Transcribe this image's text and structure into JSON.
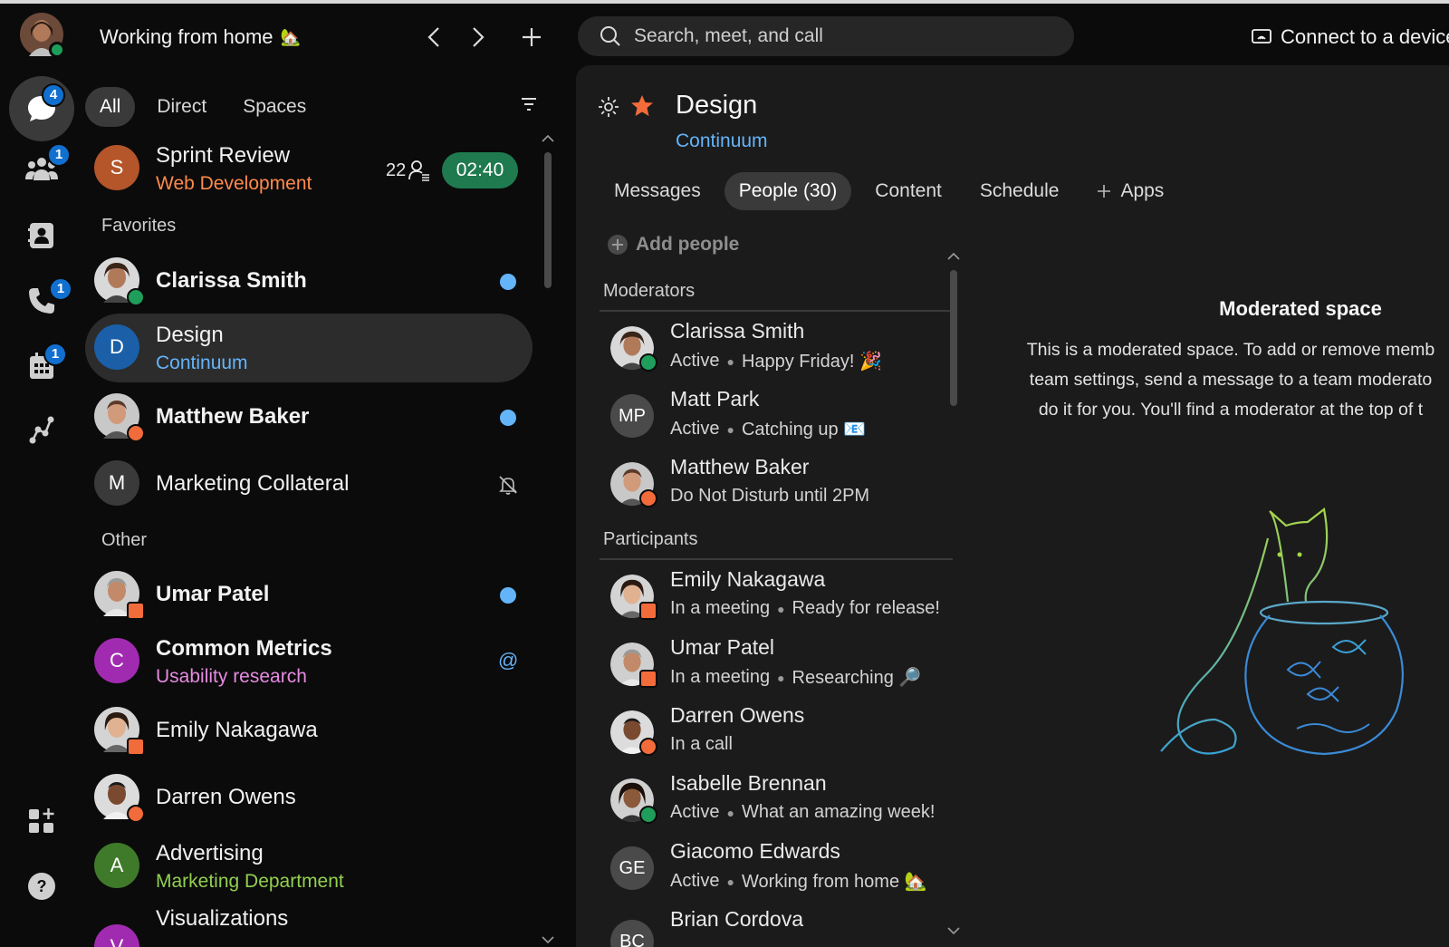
{
  "topbar": {
    "status_text": "Working from home",
    "status_emoji": "🏡",
    "search_placeholder": "Search, meet, and call",
    "connect_label": "Connect to a device",
    "back_symbol": "‹",
    "forward_symbol": "›",
    "new_symbol": "+"
  },
  "rail": {
    "items": [
      {
        "name": "messaging",
        "icon": "chat-bubble-icon",
        "badge": "4"
      },
      {
        "name": "teams",
        "icon": "people-icon",
        "badge": "1"
      },
      {
        "name": "contacts",
        "icon": "contact-card-icon",
        "badge": ""
      },
      {
        "name": "calling",
        "icon": "phone-icon",
        "badge": "1"
      },
      {
        "name": "meetings",
        "icon": "calendar-icon",
        "badge": "1"
      },
      {
        "name": "workflows",
        "icon": "network-icon",
        "badge": ""
      },
      {
        "name": "apps",
        "icon": "app-grid-icon",
        "badge": ""
      },
      {
        "name": "help",
        "icon": "help-icon",
        "badge": ""
      }
    ]
  },
  "list": {
    "filters": [
      "All",
      "Direct",
      "Spaces"
    ],
    "active_filter": "All",
    "favorites_label": "Favorites",
    "other_label": "Other",
    "meeting": {
      "name": "Sprint Review",
      "sub": "Web Development",
      "initial": "S",
      "count": "22",
      "timer": "02:40"
    },
    "favorites": [
      {
        "name": "Clarissa Smith",
        "sub": "",
        "initial": "",
        "bold": true,
        "unread": true
      },
      {
        "name": "Design",
        "sub": "Continuum",
        "initial": "D",
        "bold": false,
        "unread": false
      },
      {
        "name": "Matthew Baker",
        "sub": "",
        "initial": "",
        "bold": true,
        "unread": true
      },
      {
        "name": "Marketing Collateral",
        "sub": "",
        "initial": "M",
        "bold": false,
        "unread": false
      }
    ],
    "other": [
      {
        "name": "Umar Patel",
        "sub": "",
        "bold": true
      },
      {
        "name": "Common Metrics",
        "sub": "Usability research",
        "initial": "C",
        "bold": true
      },
      {
        "name": "Emily Nakagawa",
        "sub": "",
        "bold": false
      },
      {
        "name": "Darren Owens",
        "sub": "",
        "bold": false
      },
      {
        "name": "Advertising",
        "sub": "Marketing Department",
        "initial": "A",
        "bold": false
      },
      {
        "name": "Visualizations",
        "sub": "",
        "initial": "V",
        "bold": false
      }
    ],
    "mention_symbol": "@"
  },
  "space": {
    "title": "Design",
    "subtitle": "Continuum",
    "tabs": [
      "Messages",
      "People (30)",
      "Content",
      "Schedule",
      "Apps"
    ],
    "active_tab": "People (30)",
    "add_people": "Add people",
    "moderators_label": "Moderators",
    "participants_label": "Participants",
    "moderators": [
      {
        "name": "Clarissa Smith",
        "availability": "Active",
        "message": "Happy Friday! 🎉",
        "initials": ""
      },
      {
        "name": "Matt Park",
        "availability": "Active",
        "message": "Catching up 📧",
        "initials": "MP"
      },
      {
        "name": "Matthew Baker",
        "availability": "Do Not Disturb until 2PM",
        "message": "",
        "initials": ""
      }
    ],
    "participants": [
      {
        "name": "Emily Nakagawa",
        "availability": "In a meeting",
        "message": "Ready for release!",
        "initials": ""
      },
      {
        "name": "Umar Patel",
        "availability": "In a meeting",
        "message": "Researching 🔎",
        "initials": ""
      },
      {
        "name": "Darren Owens",
        "availability": "In a call",
        "message": "",
        "initials": ""
      },
      {
        "name": "Isabelle Brennan",
        "availability": "Active",
        "message": "What an amazing week!",
        "initials": ""
      },
      {
        "name": "Giacomo Edwards",
        "availability": "Active",
        "message": "Working from home 🏡",
        "initials": "GE"
      },
      {
        "name": "Brian Cordova",
        "availability": "",
        "message": "",
        "initials": "BC"
      }
    ],
    "info_title": "Moderated space",
    "info_lines": [
      "This is a moderated space. To add or remove memb",
      "team settings, send a message to a team moderato",
      "do it for you. You'll find a moderator at the top of t"
    ]
  },
  "colors": {
    "accent_blue": "#64b4fa",
    "badge_blue": "#1170cf",
    "presence_green": "#1f9d5a",
    "dnd_orange": "#f26b3a",
    "meeting_green": "#1f7a4f",
    "sub_orange": "#ff8a4c",
    "sub_pink": "#e58be0",
    "sub_lime": "#92d050",
    "star_orange": "#f26b3a"
  }
}
